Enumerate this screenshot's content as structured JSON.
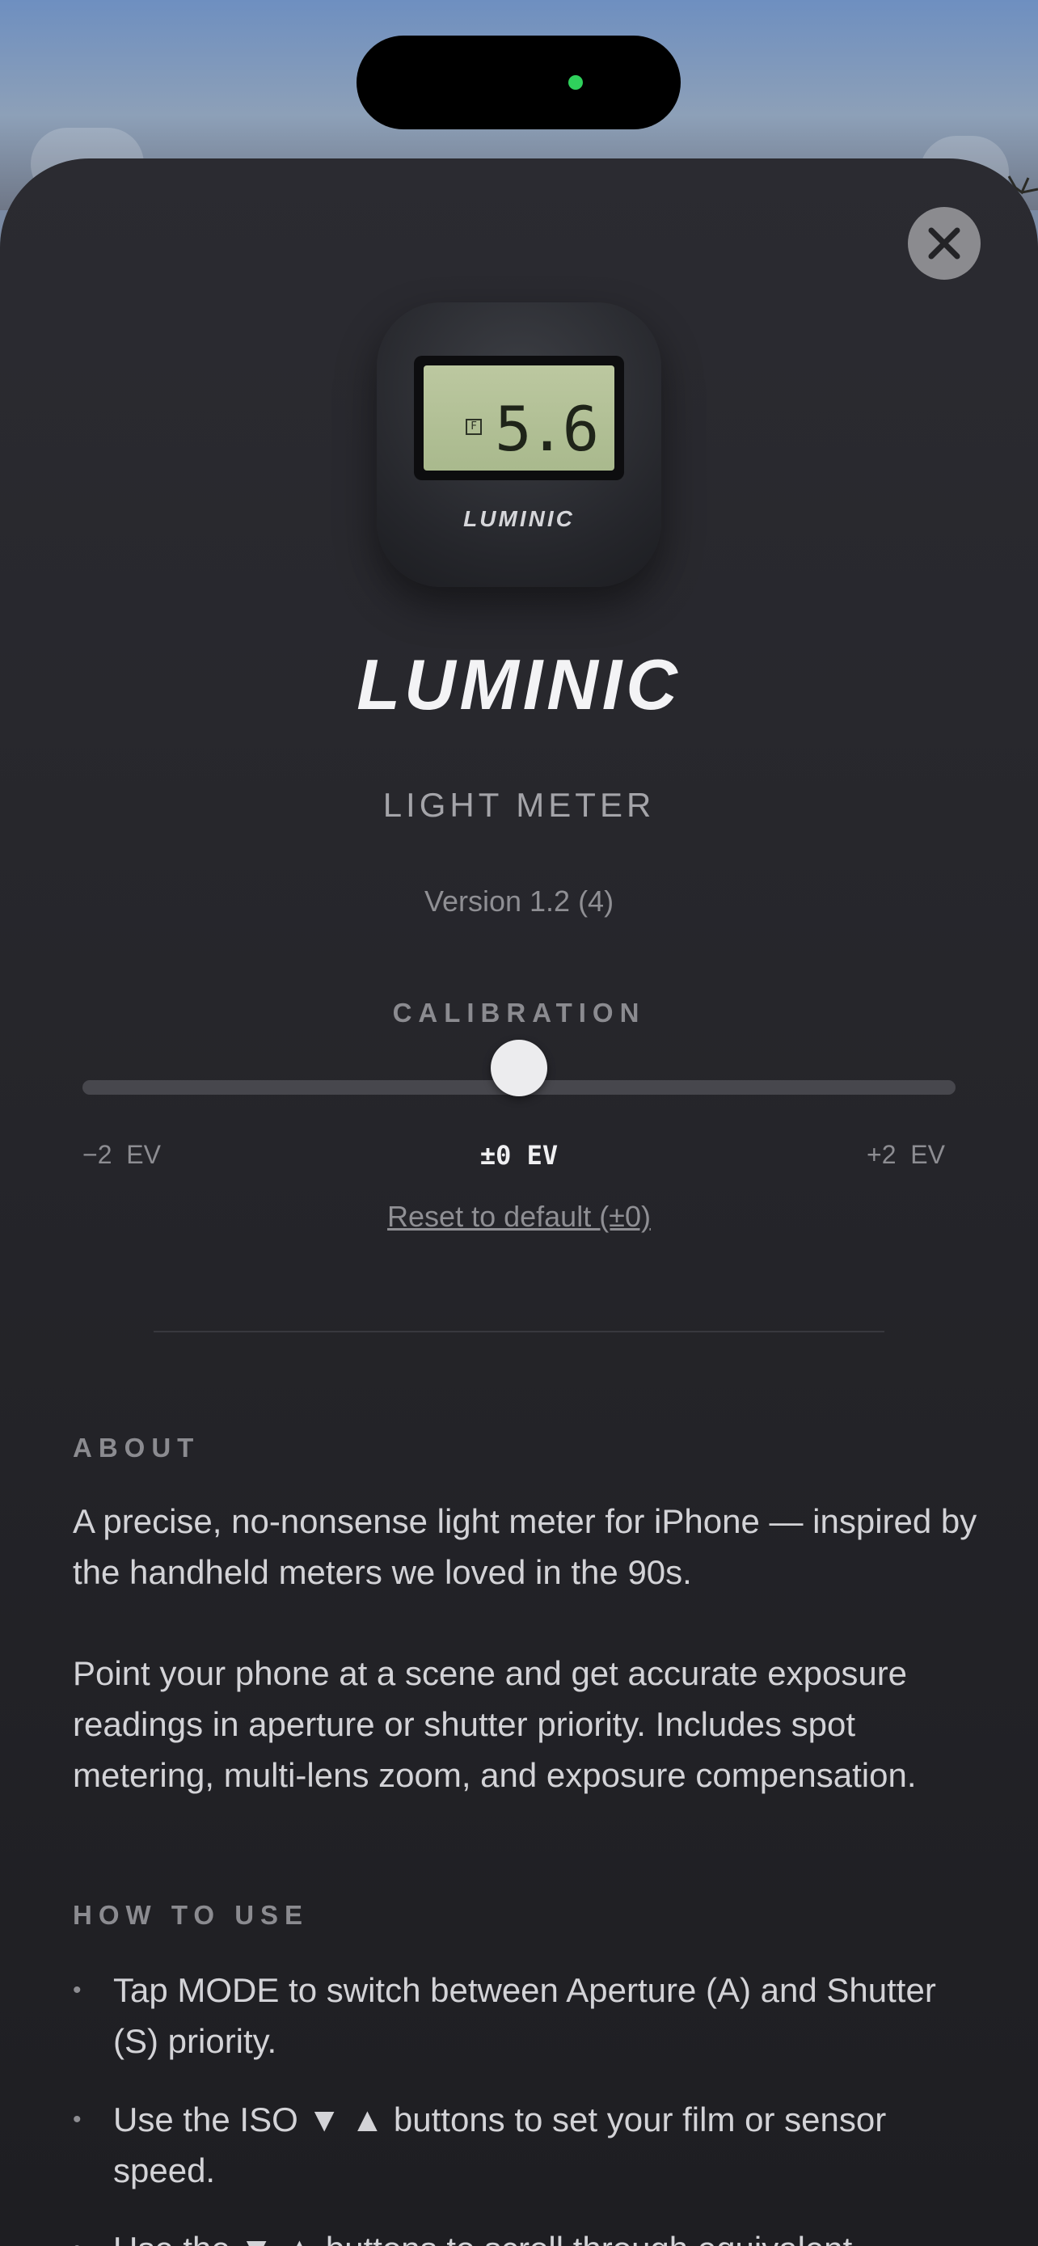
{
  "app": {
    "icon_label": "LUMINIC",
    "lcd": {
      "mode_indicator": "F",
      "value": "5.6"
    },
    "title": "LUMINIC",
    "subtitle": "LIGHT METER",
    "version": "Version 1.2 (4)"
  },
  "calibration": {
    "heading": "CALIBRATION",
    "min_label": "−2  EV",
    "max_label": "+2  EV",
    "current_label": "±0 EV",
    "value_ev": 0,
    "range_ev": [
      -2,
      2
    ],
    "reset_label": "Reset to default (±0)"
  },
  "about": {
    "heading": "ABOUT",
    "paragraphs": [
      "A precise, no-nonsense light meter for iPhone — inspired by the handheld meters we loved in the 90s.",
      "Point your phone at a scene and get accurate exposure readings in aperture or shutter priority. Includes spot metering, multi-lens zoom, and exposure compensation."
    ]
  },
  "how_to_use": {
    "heading": "HOW TO USE",
    "bullet": "•",
    "items": [
      "Tap MODE to switch between Aperture (A) and Shutter (S) priority.",
      "Use the ISO ▼ ▲ buttons to set your film or sensor speed.",
      "Use the ▼ ▲ buttons to scroll through equivalent"
    ]
  },
  "icons": {
    "close": "close-icon",
    "dynamic_island_indicator": "green-indicator-dot"
  },
  "colors": {
    "sheet_background": "#26262b",
    "lcd_background": "#b3c295",
    "indicator_dot": "#2fd15c",
    "close_button": "#8b8b8f"
  }
}
